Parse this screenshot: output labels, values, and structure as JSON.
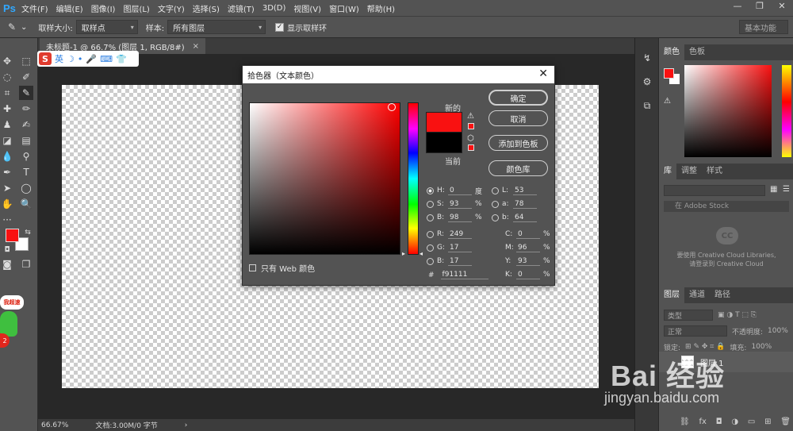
{
  "app": {
    "logo": "Ps"
  },
  "menu": [
    "文件(F)",
    "编辑(E)",
    "图像(I)",
    "图层(L)",
    "文字(Y)",
    "选择(S)",
    "滤镜(T)",
    "3D(D)",
    "视图(V)",
    "窗口(W)",
    "帮助(H)"
  ],
  "window_controls": {
    "minimize": "—",
    "restore": "❐",
    "close": "✕"
  },
  "options_bar": {
    "sample_size_label": "取样大小:",
    "sample_size_value": "取样点",
    "sample_label": "样本:",
    "sample_value": "所有图层",
    "show_ring_label": "显示取样环",
    "show_ring_checked": true,
    "workspace_value": "基本功能"
  },
  "document": {
    "tab_title": "未标题-1 @ 66.7% (图层 1, RGB/8#)",
    "tab_close": "×",
    "zoom": "66.67%",
    "doc_info": "文档:3.00M/0 字节",
    "status_arrow": "›"
  },
  "color_picker": {
    "title": "拾色器（文本颜色）",
    "close": "✕",
    "new_label": "新的",
    "current_label": "当前",
    "new_color": "#f91111",
    "current_color": "#000000",
    "buttons": {
      "ok": "确定",
      "cancel": "取消",
      "add_swatch": "添加到色板",
      "color_library": "颜色库"
    },
    "fields": {
      "H": {
        "label": "H:",
        "value": "0",
        "unit": "度"
      },
      "S": {
        "label": "S:",
        "value": "93",
        "unit": "%"
      },
      "Bv": {
        "label": "B:",
        "value": "98",
        "unit": "%"
      },
      "R": {
        "label": "R:",
        "value": "249"
      },
      "G": {
        "label": "G:",
        "value": "17"
      },
      "Bc": {
        "label": "B:",
        "value": "17"
      },
      "L": {
        "label": "L:",
        "value": "53"
      },
      "a": {
        "label": "a:",
        "value": "78"
      },
      "b": {
        "label": "b:",
        "value": "64"
      },
      "C": {
        "label": "C:",
        "value": "0",
        "unit": "%"
      },
      "M": {
        "label": "M:",
        "value": "96",
        "unit": "%"
      },
      "Y": {
        "label": "Y:",
        "value": "93",
        "unit": "%"
      },
      "K": {
        "label": "K:",
        "value": "0",
        "unit": "%"
      }
    },
    "hex_label": "#",
    "hex_value": "f91111",
    "web_only_label": "只有 Web 颜色"
  },
  "panels": {
    "color_tabs": [
      "颜色",
      "色板"
    ],
    "library_tabs": [
      "库",
      "调整",
      "样式"
    ],
    "library_search_placeholder": "在 Adobe Stock",
    "cc_line1": "要使用 Creative Cloud Libraries,",
    "cc_line2": "请登录到 Creative Cloud",
    "layers_tabs": [
      "图层",
      "通道",
      "路径"
    ],
    "layer_filter": "类型",
    "blend_mode": "正常",
    "opacity_label": "不透明度:",
    "opacity_value": "100%",
    "lock_label": "锁定:",
    "fill_label": "填充:",
    "fill_value": "100%",
    "layer_name": "图层 1"
  },
  "ime_bar": {
    "logo": "S",
    "mode": "英"
  },
  "sticker": {
    "bubble_text": "我超速",
    "badge": "2"
  },
  "watermark": {
    "brand": "Bai 经验",
    "url": "jingyan.baidu.com"
  }
}
